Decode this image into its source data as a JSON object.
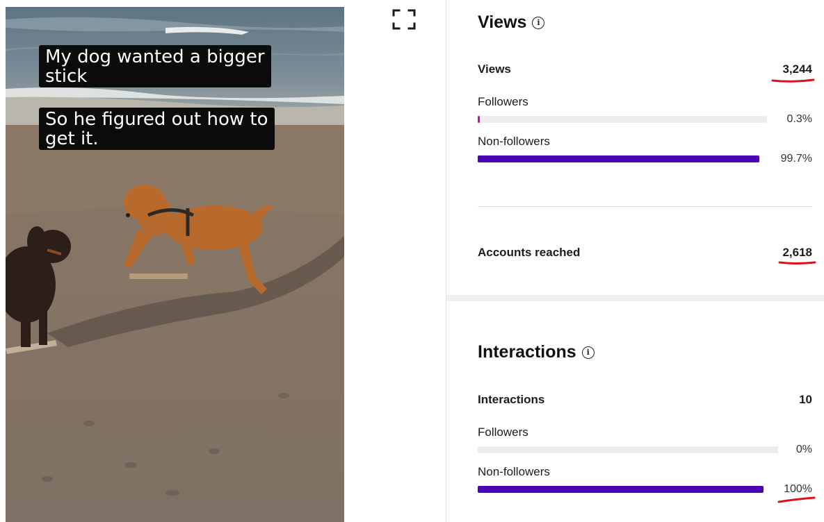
{
  "video": {
    "captions": [
      {
        "line1": "My dog wanted a bigger",
        "line2": "stick"
      },
      {
        "line1": "So he figured out how to",
        "line2": "get it."
      }
    ]
  },
  "expand_icon": "expand-fullscreen-icon",
  "views": {
    "title": "Views",
    "total_label": "Views",
    "total_value": "3,244",
    "followers_label": "Followers",
    "followers_pct": "0.3%",
    "followers_fraction": 0.003,
    "nonfollowers_label": "Non-followers",
    "nonfollowers_pct": "99.7%",
    "nonfollowers_fraction": 0.997,
    "accounts_label": "Accounts reached",
    "accounts_value": "2,618"
  },
  "interactions": {
    "title": "Interactions",
    "total_label": "Interactions",
    "total_value": "10",
    "followers_label": "Followers",
    "followers_pct": "0%",
    "followers_fraction": 0,
    "nonfollowers_label": "Non-followers",
    "nonfollowers_pct": "100%",
    "nonfollowers_fraction": 1.0
  },
  "colors": {
    "bar_primary": "#4b05b7",
    "bar_small": "#c20fa4",
    "track": "#ececec",
    "annotation": "#e0101a"
  }
}
